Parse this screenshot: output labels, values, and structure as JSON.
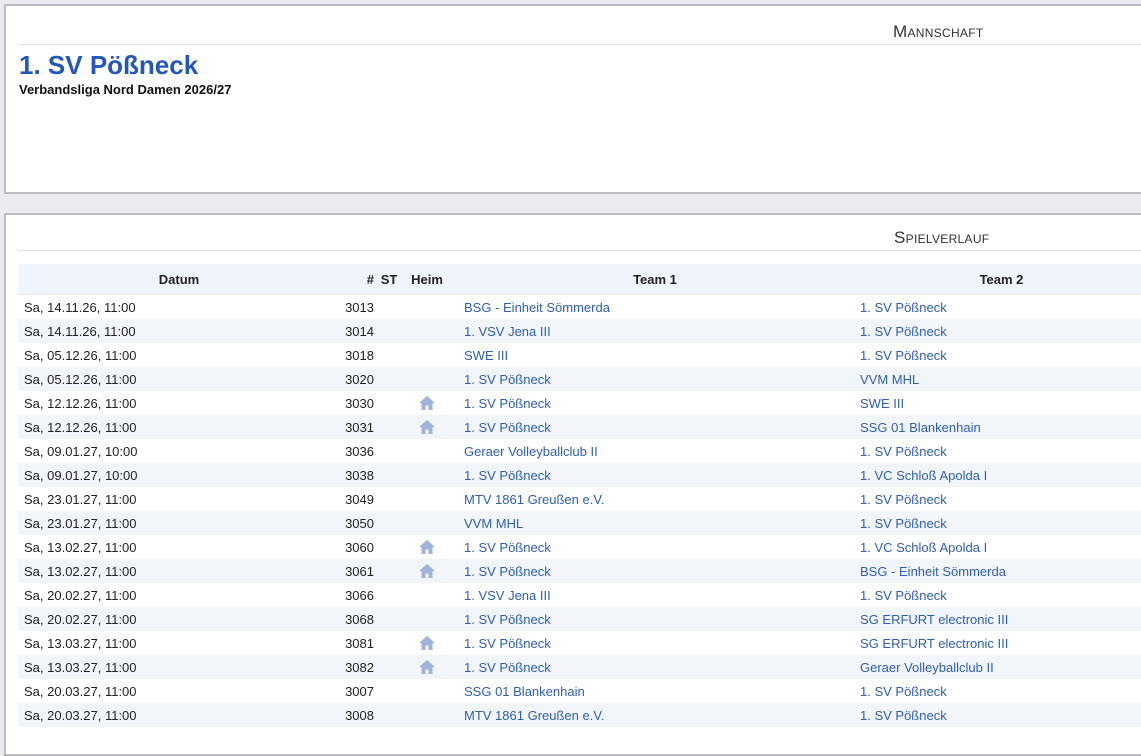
{
  "header": {
    "section_title": "Mannschaft",
    "team_name": "1. SV Pößneck",
    "league": "Verbandsliga Nord Damen 2026/27"
  },
  "schedule": {
    "section_title": "Spielverlauf",
    "columns": {
      "date": "Datum",
      "number": "#",
      "st": "ST",
      "home": "Heim",
      "team1": "Team 1",
      "team2": "Team 2"
    },
    "rows": [
      {
        "date": "Sa, 14.11.26, 11:00",
        "number": "3013",
        "home": false,
        "team1": "BSG - Einheit Sömmerda",
        "team2": "1. SV Pößneck"
      },
      {
        "date": "Sa, 14.11.26, 11:00",
        "number": "3014",
        "home": false,
        "team1": "1. VSV Jena III",
        "team2": "1. SV Pößneck"
      },
      {
        "date": "Sa, 05.12.26, 11:00",
        "number": "3018",
        "home": false,
        "team1": "SWE III",
        "team2": "1. SV Pößneck"
      },
      {
        "date": "Sa, 05.12.26, 11:00",
        "number": "3020",
        "home": false,
        "team1": "1. SV Pößneck",
        "team2": "VVM MHL"
      },
      {
        "date": "Sa, 12.12.26, 11:00",
        "number": "3030",
        "home": true,
        "team1": "1. SV Pößneck",
        "team2": "SWE III"
      },
      {
        "date": "Sa, 12.12.26, 11:00",
        "number": "3031",
        "home": true,
        "team1": "1. SV Pößneck",
        "team2": "SSG 01 Blankenhain"
      },
      {
        "date": "Sa, 09.01.27, 10:00",
        "number": "3036",
        "home": false,
        "team1": "Geraer Volleyballclub II",
        "team2": "1. SV Pößneck"
      },
      {
        "date": "Sa, 09.01.27, 10:00",
        "number": "3038",
        "home": false,
        "team1": "1. SV Pößneck",
        "team2": "1. VC Schloß Apolda I"
      },
      {
        "date": "Sa, 23.01.27, 11:00",
        "number": "3049",
        "home": false,
        "team1": "MTV 1861 Greußen e.V.",
        "team2": "1. SV Pößneck"
      },
      {
        "date": "Sa, 23.01.27, 11:00",
        "number": "3050",
        "home": false,
        "team1": "VVM MHL",
        "team2": "1. SV Pößneck"
      },
      {
        "date": "Sa, 13.02.27, 11:00",
        "number": "3060",
        "home": true,
        "team1": "1. SV Pößneck",
        "team2": "1. VC Schloß Apolda I"
      },
      {
        "date": "Sa, 13.02.27, 11:00",
        "number": "3061",
        "home": true,
        "team1": "1. SV Pößneck",
        "team2": "BSG - Einheit Sömmerda"
      },
      {
        "date": "Sa, 20.02.27, 11:00",
        "number": "3066",
        "home": false,
        "team1": "1. VSV Jena III",
        "team2": "1. SV Pößneck"
      },
      {
        "date": "Sa, 20.02.27, 11:00",
        "number": "3068",
        "home": false,
        "team1": "1. SV Pößneck",
        "team2": "SG ERFURT electronic III"
      },
      {
        "date": "Sa, 13.03.27, 11:00",
        "number": "3081",
        "home": true,
        "team1": "1. SV Pößneck",
        "team2": "SG ERFURT electronic III"
      },
      {
        "date": "Sa, 13.03.27, 11:00",
        "number": "3082",
        "home": true,
        "team1": "1. SV Pößneck",
        "team2": "Geraer Volleyballclub II"
      },
      {
        "date": "Sa, 20.03.27, 11:00",
        "number": "3007",
        "home": false,
        "team1": "SSG 01 Blankenhain",
        "team2": "1. SV Pößneck"
      },
      {
        "date": "Sa, 20.03.27, 11:00",
        "number": "3008",
        "home": false,
        "team1": "MTV 1861 Greußen e.V.",
        "team2": "1. SV Pößneck"
      }
    ]
  },
  "colors": {
    "accent": "#2457b8",
    "link": "#2f5fb0",
    "home_icon": "#9fb3dc",
    "row_stripe": "#f2f6fb"
  }
}
